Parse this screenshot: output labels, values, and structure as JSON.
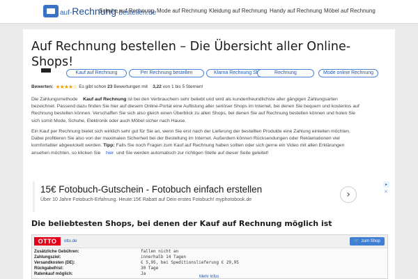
{
  "header": {
    "logo_prefix": "auf-",
    "logo_main": "Rechnung",
    "logo_suffix": "-bestellen.de",
    "nav": [
      "Schuhe auf Rechnung",
      "Mode auf Rechnung",
      "Kleidung auf Rechnung",
      "Handy auf Rechnung",
      "Möbel auf Rechnung"
    ]
  },
  "main": {
    "title": "Auf Rechnung bestellen – Die Übersicht aller Online-Shops!",
    "pills": [
      "Kauf auf Rechnung",
      "Per Rechnung bestellen",
      "Klarna Rechnung Shops",
      "Rechnung",
      "Mode online Rechnung"
    ],
    "rating": {
      "label": "Bewerten:",
      "stars": "★★★★☆",
      "prefix": "Es gibt schon",
      "count": "23",
      "count_suffix": "Bewertungen mit",
      "score": "3,22",
      "score_suffix": "von 1 bis 5 Sternen!"
    },
    "para1_start": "Die Zahlungsmethode",
    "para1_bold": "Kauf auf Rechnung",
    "para1_rest": "ist bei den Verbrauchern sehr beliebt und wird als kundenfreundlichste aller gängigen Zahlungsarten bezeichnet. Passend dazu finden Sie hier auf diesem Online-Portal eine Auflistung aller seriöser Shops im Internet, bei denen Sie bequem und kostenlos auf Rechnung bestellen können. Verschaffen Sie sich also gleich einen Überblick zu allen Shops, bei denen Sie auf Rechnung bestellen können und holen Sie sich somit Mode, Schuhe, Elektronik oder auch Möbel sicher nach Hause.",
    "para2_start": "Ein Kauf per Rechnung bietet sich wirklich sehr gut für Sie an, wenn Sie erst nach der Lieferung der bestellten Produkte eine Zahlung einleiten möchten. Dabei profitieren Sie also von der maximalen Sicherheit bei der Bestellung im Internet. Außerdem können Rücksendungen oder Reklamationen viel komfortabler abgewickelt werden.",
    "para2_tip": "Tipp:",
    "para2_mid": "Falls Sie noch Fragen zum Kauf auf Rechnung haben sollten oder sich gerne ein Video mit allen Erklärungen ansehen möchten, so klicken Sie",
    "para2_link": "hier",
    "para2_end": "und Sie werden automatisch zur richtigen Stelle auf dieser Seite geleitet!"
  },
  "ad": {
    "title": "15€ Fotobuch-Gutschein - Fotobuch einfach erstellen",
    "subtitle": "Über 10 Jahre Fotobuch-Erfahrung. Heute:15€ Rabatt auf Dein erstes Fotobuch! myphotobook.de",
    "arrow": "›",
    "badge": "▸",
    "close": "✕"
  },
  "shops": {
    "section_title": "Die beliebtesten Shops, bei denen der Kauf auf Rechnung möglich ist",
    "card": {
      "logo": "OTTO",
      "url": "otto.de",
      "button": "zum Shop",
      "cart_icon": "🛒",
      "rows": [
        {
          "key": "Zusätzliche Gebühren:",
          "value": "fallen nicht an"
        },
        {
          "key": "Zahlungsziel:",
          "value": "innerhalb 14 Tagen"
        },
        {
          "key": "Versandkosten (DE):",
          "value": "€ 5,95, bei Speditionslieferung € 29,95"
        },
        {
          "key": "Rückgabefrist:",
          "value": "30 Tage"
        },
        {
          "key": "Ratenkauf möglich:",
          "value": "Ja"
        }
      ],
      "more": "Mehr Infos"
    }
  }
}
